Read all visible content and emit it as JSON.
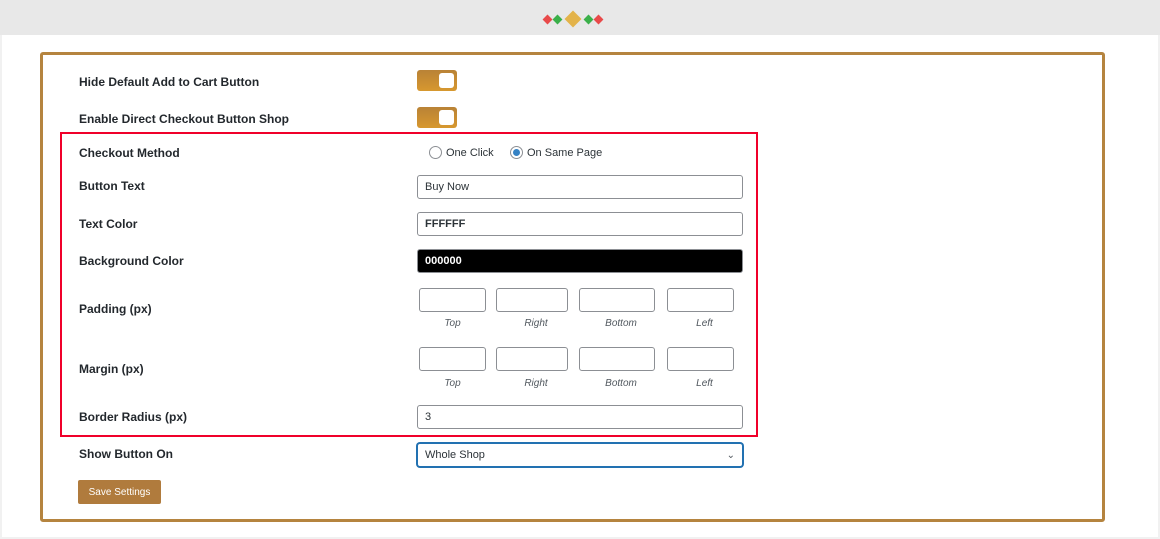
{
  "colors": {
    "accent": "#b5843f",
    "highlight": "#f0002a"
  },
  "rows": {
    "hide_default": "Hide Default Add to Cart Button",
    "enable_direct": "Enable Direct Checkout Button Shop",
    "checkout_method": "Checkout Method",
    "checkout_options": [
      "One Click",
      "On Same Page"
    ],
    "checkout_selected": "On Same Page",
    "button_text": "Button Text",
    "button_text_value": "Buy Now",
    "text_color": "Text Color",
    "text_color_value": "FFFFFF",
    "bg_color": "Background Color",
    "bg_color_value": "000000",
    "padding": "Padding (px)",
    "margin": "Margin (px)",
    "sides": [
      "Top",
      "Right",
      "Bottom",
      "Left"
    ],
    "border_radius": "Border Radius (px)",
    "border_radius_value": "3",
    "show_on": "Show Button On",
    "show_on_value": "Whole Shop"
  },
  "save_label": "Save Settings"
}
